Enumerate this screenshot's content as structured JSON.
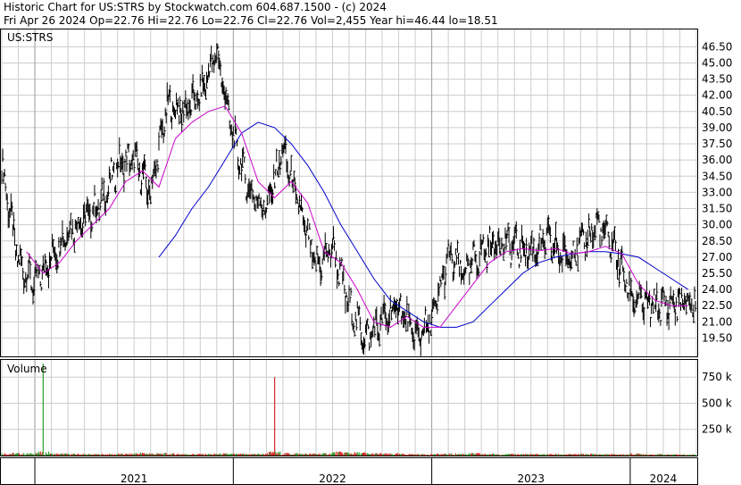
{
  "header": {
    "line1": "Historic Chart for US:STRS by Stockwatch.com 604.687.1500 - (c) 2024",
    "line2": "Fri Apr 26 2024   Op=22.76   Hi=22.76   Lo=22.76   Cl=22.76   Vol=2,455   Year hi=46.44   lo=18.51"
  },
  "price_panel": {
    "label": "US:STRS"
  },
  "volume_panel": {
    "label": "Volume"
  },
  "colors": {
    "price_bars": "#000000",
    "ma_short": "#cc00cc",
    "ma_long": "#0000cc",
    "volume_up": "#2ca02c",
    "volume_down": "#d62728",
    "grid": "#cccccc"
  },
  "chart_data": [
    {
      "type": "line",
      "title": "US:STRS",
      "xlabel": "",
      "ylabel": "",
      "ylim": [
        17.8,
        48.1
      ],
      "x_categories": [
        "2021",
        "2022",
        "2023",
        "2024"
      ],
      "ytick_labels": [
        "46.50",
        "45.00",
        "43.50",
        "42.00",
        "40.50",
        "39.00",
        "37.50",
        "36.00",
        "34.50",
        "33.00",
        "31.50",
        "30.00",
        "28.50",
        "27.00",
        "25.50",
        "24.00",
        "22.50",
        "21.00",
        "19.50"
      ],
      "grid": true,
      "series": [
        {
          "name": "",
          "style": "high-low bars",
          "x": [
            "2020-11",
            "2020-12",
            "2021-01",
            "2021-02",
            "2021-03",
            "2021-04",
            "2021-05",
            "2021-06",
            "2021-07",
            "2021-08",
            "2021-09",
            "2021-10",
            "2021-11",
            "2021-12",
            "2022-01",
            "2022-02",
            "2022-03",
            "2022-04",
            "2022-05",
            "2022-06",
            "2022-07",
            "2022-08",
            "2022-09",
            "2022-10",
            "2022-11",
            "2022-12",
            "2023-01",
            "2023-02",
            "2023-03",
            "2023-04",
            "2023-05",
            "2023-06",
            "2023-07",
            "2023-08",
            "2023-09",
            "2023-10",
            "2023-11",
            "2023-12",
            "2024-01",
            "2024-02",
            "2024-03",
            "2024-04"
          ],
          "values": [
            35.5,
            26.5,
            24.5,
            27.0,
            29.5,
            30.5,
            32.0,
            35.5,
            36.0,
            33.0,
            41.0,
            40.5,
            42.0,
            46.0,
            38.0,
            33.0,
            31.5,
            37.0,
            31.5,
            26.0,
            28.0,
            22.5,
            19.5,
            21.0,
            22.5,
            19.5,
            21.0,
            27.0,
            25.5,
            27.5,
            28.5,
            28.0,
            27.5,
            28.5,
            27.0,
            28.0,
            30.0,
            28.0,
            23.5,
            22.5,
            22.5,
            22.76
          ]
        },
        {
          "name": "",
          "style": "moving average (short)",
          "x": [
            "2020-11",
            "2020-12",
            "2021-01",
            "2021-02",
            "2021-03",
            "2021-04",
            "2021-05",
            "2021-06",
            "2021-07",
            "2021-08",
            "2021-09",
            "2021-10",
            "2021-11",
            "2021-12",
            "2022-01",
            "2022-02",
            "2022-03",
            "2022-04",
            "2022-05",
            "2022-06",
            "2022-07",
            "2022-08",
            "2022-09",
            "2022-10",
            "2022-11",
            "2022-12",
            "2023-01",
            "2023-02",
            "2023-03",
            "2023-04",
            "2023-05",
            "2023-06",
            "2023-07",
            "2023-08",
            "2023-09",
            "2023-10",
            "2023-11",
            "2023-12",
            "2024-01",
            "2024-02",
            "2024-03",
            "2024-04"
          ],
          "values": [
            null,
            27.5,
            25.5,
            26.5,
            28.5,
            30.0,
            31.5,
            34.0,
            35.0,
            33.5,
            38.0,
            39.5,
            40.5,
            41.0,
            38.5,
            34.0,
            32.5,
            34.0,
            32.0,
            27.5,
            26.5,
            24.0,
            21.0,
            20.5,
            21.5,
            20.5,
            20.5,
            22.5,
            24.5,
            26.5,
            27.5,
            27.8,
            27.6,
            27.8,
            27.3,
            27.5,
            28.0,
            27.3,
            24.5,
            23.0,
            22.5,
            22.5
          ]
        },
        {
          "name": "",
          "style": "moving average (long)",
          "x": [
            "2021-08",
            "2021-09",
            "2021-10",
            "2021-11",
            "2021-12",
            "2022-01",
            "2022-02",
            "2022-03",
            "2022-04",
            "2022-05",
            "2022-06",
            "2022-07",
            "2022-08",
            "2022-09",
            "2022-10",
            "2022-11",
            "2022-12",
            "2023-01",
            "2023-02",
            "2023-03",
            "2023-04",
            "2023-05",
            "2023-06",
            "2023-07",
            "2023-08",
            "2023-09",
            "2023-10",
            "2023-11",
            "2023-12",
            "2024-01",
            "2024-02",
            "2024-03",
            "2024-04"
          ],
          "values": [
            27.0,
            29.0,
            31.5,
            33.5,
            36.0,
            38.5,
            39.5,
            39.0,
            37.5,
            35.5,
            33.0,
            30.0,
            27.5,
            25.0,
            23.0,
            22.0,
            21.0,
            20.5,
            20.5,
            21.0,
            22.5,
            24.0,
            25.5,
            26.5,
            27.0,
            27.3,
            27.5,
            27.5,
            27.3,
            27.0,
            26.0,
            25.0,
            24.0
          ]
        }
      ]
    },
    {
      "type": "bar",
      "title": "Volume",
      "xlabel": "",
      "ylabel": "",
      "ylim": [
        0,
        880000
      ],
      "x_categories": [
        "2021",
        "2022",
        "2023",
        "2024"
      ],
      "ytick_labels": [
        "750 k",
        "500 k",
        "250 k"
      ],
      "grid": true,
      "series": [
        {
          "name": "",
          "x": [
            "2020-11",
            "2020-12",
            "2021-01",
            "2021-02",
            "2021-03",
            "2021-04",
            "2021-05",
            "2021-06",
            "2021-07",
            "2021-08",
            "2021-09",
            "2021-10",
            "2021-11",
            "2021-12",
            "2022-01",
            "2022-02",
            "2022-03",
            "2022-04",
            "2022-05",
            "2022-06",
            "2022-07",
            "2022-08",
            "2022-09",
            "2022-10",
            "2022-11",
            "2022-12",
            "2023-01",
            "2023-02",
            "2023-03",
            "2023-04",
            "2023-05",
            "2023-06",
            "2023-07",
            "2023-08",
            "2023-09",
            "2023-10",
            "2023-11",
            "2023-12",
            "2024-01",
            "2024-02",
            "2024-03",
            "2024-04"
          ],
          "values": [
            40000,
            35000,
            880000,
            30000,
            25000,
            20000,
            22000,
            28000,
            45000,
            35000,
            30000,
            25000,
            25000,
            30000,
            25000,
            28000,
            750000,
            40000,
            30000,
            35000,
            120000,
            50000,
            35000,
            30000,
            25000,
            20000,
            25000,
            30000,
            35000,
            25000,
            22000,
            25000,
            20000,
            22000,
            20000,
            25000,
            20000,
            18000,
            30000,
            20000,
            15000,
            12000
          ]
        }
      ]
    }
  ]
}
